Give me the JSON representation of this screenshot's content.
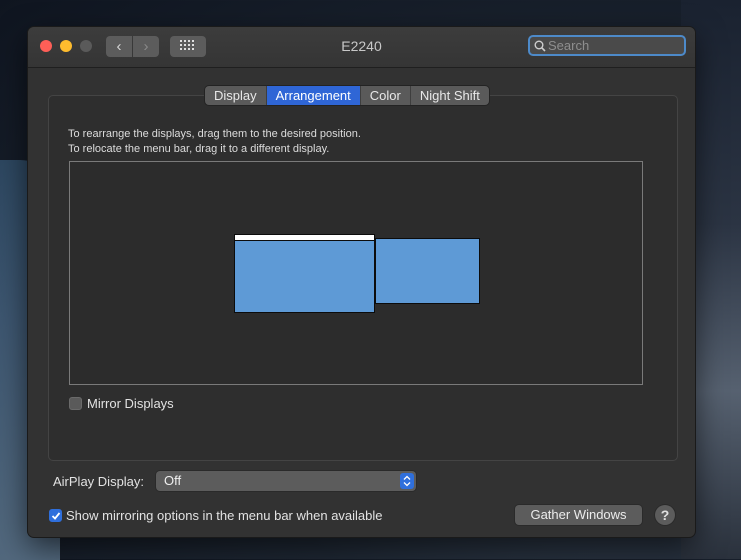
{
  "window": {
    "title": "E2240"
  },
  "toolbar": {
    "back": "‹",
    "forward": "›"
  },
  "search": {
    "placeholder": "Search",
    "value": ""
  },
  "tabs": [
    {
      "label": "Display",
      "active": false
    },
    {
      "label": "Arrangement",
      "active": true
    },
    {
      "label": "Color",
      "active": false
    },
    {
      "label": "Night Shift",
      "active": false
    }
  ],
  "instructions": {
    "line1": "To rearrange the displays, drag them to the desired position.",
    "line2": "To relocate the menu bar, drag it to a different display."
  },
  "mirror_displays": {
    "label": "Mirror Displays",
    "checked": false
  },
  "airplay": {
    "label": "AirPlay Display:",
    "value": "Off"
  },
  "show_mirroring": {
    "label": "Show mirroring options in the menu bar when available",
    "checked": true
  },
  "gather_button": {
    "label": "Gather Windows"
  },
  "help_button": {
    "label": "?"
  },
  "colors": {
    "accent": "#2f66d6",
    "display_fill": "#5e9ad6",
    "window_bg": "#323232"
  }
}
